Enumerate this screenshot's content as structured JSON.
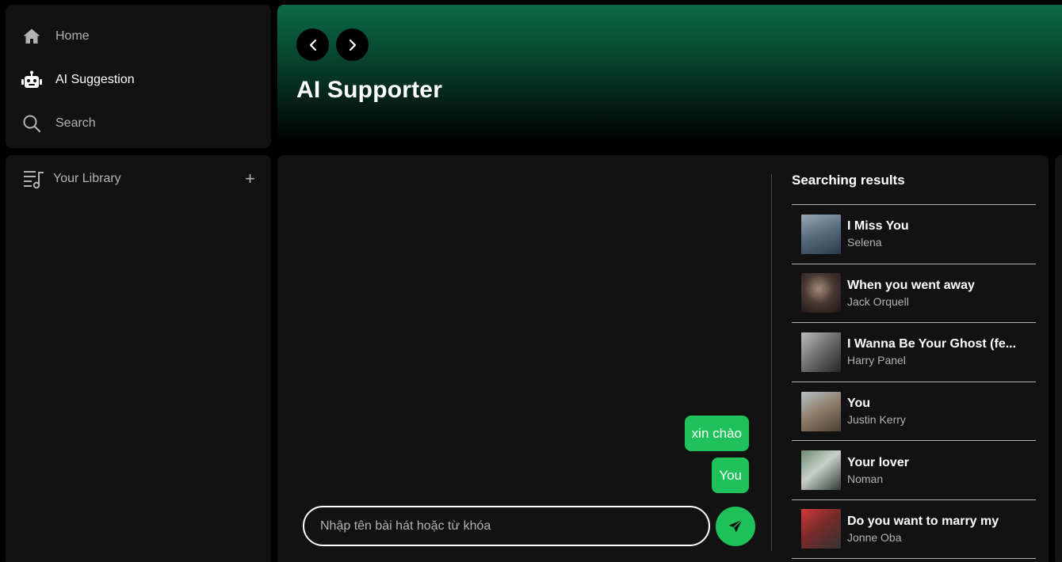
{
  "nav": {
    "items": [
      {
        "label": "Home",
        "icon": "home-icon",
        "active": false
      },
      {
        "label": "AI Suggestion",
        "icon": "robot-icon",
        "active": true
      },
      {
        "label": "Search",
        "icon": "search-icon",
        "active": false
      }
    ]
  },
  "library": {
    "label": "Your Library",
    "add_icon": "plus-icon"
  },
  "header": {
    "title": "AI Supporter"
  },
  "chat": {
    "messages": [
      "xin chào",
      "You"
    ],
    "input_placeholder": "Nhập tên bài hát hoặc từ khóa",
    "input_value": ""
  },
  "results": {
    "title": "Searching results",
    "items": [
      {
        "title": "I Miss You",
        "artist": "Selena"
      },
      {
        "title": "When you went away",
        "artist": "Jack Orquell"
      },
      {
        "title": "I Wanna Be Your Ghost (fe...",
        "artist": "Harry Panel"
      },
      {
        "title": "You",
        "artist": "Justin Kerry"
      },
      {
        "title": "Your lover",
        "artist": "Noman"
      },
      {
        "title": "Do you want to marry my",
        "artist": "Jonne Oba"
      }
    ]
  },
  "colors": {
    "accent": "#1fc25a",
    "panel": "#121212",
    "header_top": "#0a6b47"
  }
}
